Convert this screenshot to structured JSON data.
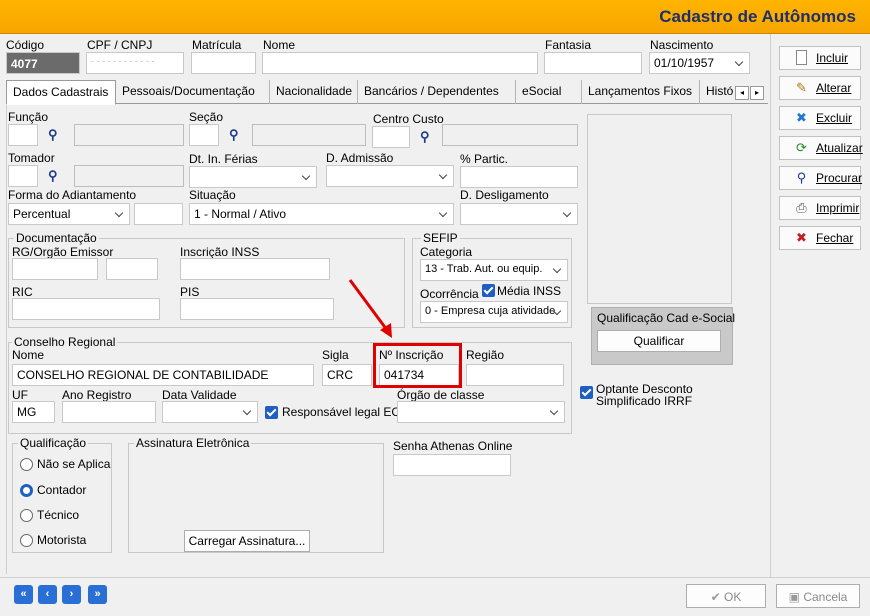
{
  "window": {
    "title": "Cadastro de Autônomos"
  },
  "header": {
    "codigo_label": "Código",
    "codigo_value": "4077",
    "cpf_label": "CPF / CNPJ",
    "cpf_value": "- - - - - - - - - - - -",
    "matricula_label": "Matrícula",
    "nome_label": "Nome",
    "fantasia_label": "Fantasia",
    "nascimento_label": "Nascimento",
    "nascimento_value": "01/10/1957"
  },
  "tabs": [
    "Dados Cadastrais",
    "Pessoais/Documentação",
    "Nacionalidade",
    "Bancários / Dependentes",
    "eSocial",
    "Lançamentos Fixos",
    "Históri"
  ],
  "fields": {
    "funcao": "Função",
    "secao": "Seção",
    "centro_custo": "Centro Custo",
    "tomador": "Tomador",
    "dt_ferias": "Dt. In. Férias",
    "d_admissao": "D. Admissão",
    "partic": "% Partic.",
    "forma_adiant": "Forma do Adiantamento",
    "forma_adiant_value": "Percentual",
    "situacao": "Situação",
    "situacao_value": "1 - Normal / Ativo",
    "d_desligamento": "D. Desligamento"
  },
  "documentacao": {
    "title": "Documentação",
    "rg": "RG/Orgão Emissor",
    "inss": "Inscrição INSS",
    "ric": "RIC",
    "pis": "PIS"
  },
  "sefip": {
    "title": "SEFIP",
    "categoria": "Categoria",
    "categoria_value": "13 - Trab. Aut. ou equip.",
    "ocorrencia": "Ocorrência",
    "media_inss": "Média INSS",
    "ocorrencia_value": "0 - Empresa cuja atividade"
  },
  "esocial": {
    "title": "Qualificação Cad e-Social",
    "button": "Qualificar"
  },
  "conselho": {
    "title": "Conselho Regional",
    "nome_label": "Nome",
    "nome_value": "CONSELHO REGIONAL DE CONTABILIDADE",
    "sigla_label": "Sigla",
    "sigla_value": "CRC",
    "inscricao_label": "Nº Inscrição",
    "inscricao_value": "041734",
    "regiao_label": "Região",
    "uf_label": "UF",
    "uf_value": "MG",
    "ano_label": "Ano Registro",
    "validade_label": "Data Validade",
    "responsavel": "Responsável legal ECD",
    "orgao_label": "Órgão de classe"
  },
  "optante": {
    "line1": "Optante Desconto",
    "line2": "Simplificado IRRF"
  },
  "qualificacao": {
    "title": "Qualificação",
    "options": [
      "Não se Aplica",
      "Contador",
      "Técnico",
      "Motorista"
    ],
    "selected": "Contador"
  },
  "assinatura": {
    "title": "Assinatura Eletrônica",
    "button": "Carregar Assinatura..."
  },
  "senha": {
    "label": "Senha Athenas Online"
  },
  "side_buttons": [
    "Incluir",
    "Alterar",
    "Excluir",
    "Atualizar",
    "Procurar",
    "Imprimir",
    "Fechar"
  ],
  "footer": {
    "ok": "OK",
    "cancel": "Cancela"
  },
  "colors": {
    "title_bar": "#f6a500",
    "title_text": "#1e2f6b",
    "highlight": "#e00000",
    "accent": "#1f5fc4"
  }
}
